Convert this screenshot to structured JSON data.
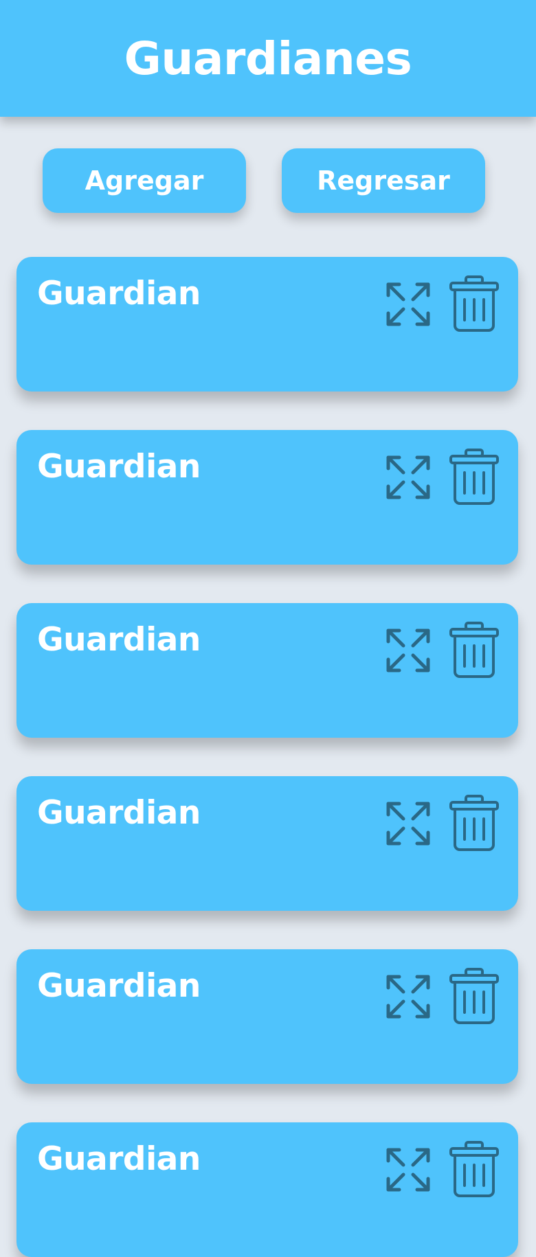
{
  "header": {
    "title": "Guardianes"
  },
  "actions": {
    "add_label": "Agregar",
    "back_label": "Regresar"
  },
  "cards": [
    {
      "title": "Guardian"
    },
    {
      "title": "Guardian"
    },
    {
      "title": "Guardian"
    },
    {
      "title": "Guardian"
    },
    {
      "title": "Guardian"
    },
    {
      "title": "Guardian"
    }
  ],
  "icons": {
    "expand": "expand-arrows-icon",
    "delete": "trash-icon"
  },
  "colors": {
    "primary": "#4fc3fc",
    "background": "#e3e9f0",
    "icon_stroke": "#2a6886",
    "text": "#ffffff"
  }
}
